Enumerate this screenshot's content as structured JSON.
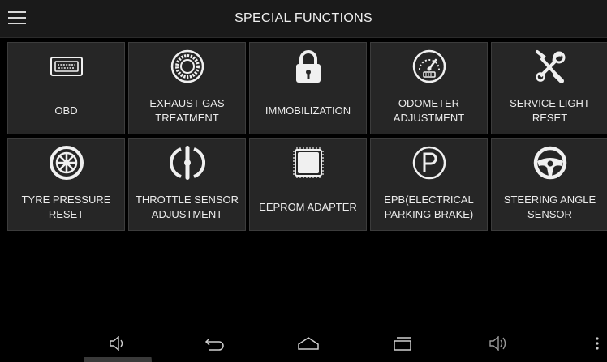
{
  "header": {
    "title": "SPECIAL FUNCTIONS",
    "menu_icon": "hamburger-menu-icon"
  },
  "functions": [
    {
      "label": "OBD",
      "icon": "obd-connector-icon"
    },
    {
      "label": "EXHAUST GAS\nTREATMENT",
      "icon": "exhaust-filter-icon"
    },
    {
      "label": "IMMOBILIZATION",
      "icon": "padlock-icon"
    },
    {
      "label": "ODOMETER\nADJUSTMENT",
      "icon": "odometer-icon"
    },
    {
      "label": "SERVICE LIGHT\nRESET",
      "icon": "wrench-screwdriver-icon"
    },
    {
      "label": "TYRE PRESSURE\nRESET",
      "icon": "tyre-icon"
    },
    {
      "label": "THROTTLE SENSOR\nADJUSTMENT",
      "icon": "throttle-icon"
    },
    {
      "label": "EEPROM ADAPTER",
      "icon": "chip-icon"
    },
    {
      "label": "EPB(ELECTRICAL\nPARKING BRAKE)",
      "icon": "parking-brake-icon"
    },
    {
      "label": "STEERING ANGLE\nSENSOR",
      "icon": "steering-wheel-icon"
    }
  ],
  "navbar": {
    "items": [
      "volume-down-icon",
      "back-icon",
      "home-icon",
      "recent-apps-icon",
      "volume-up-icon",
      "overflow-menu-icon"
    ]
  },
  "colors": {
    "background": "#000000",
    "tile": "#262626",
    "tile_border": "#3c3c3c",
    "topbar": "#1a1a1a",
    "text": "#ececec"
  }
}
